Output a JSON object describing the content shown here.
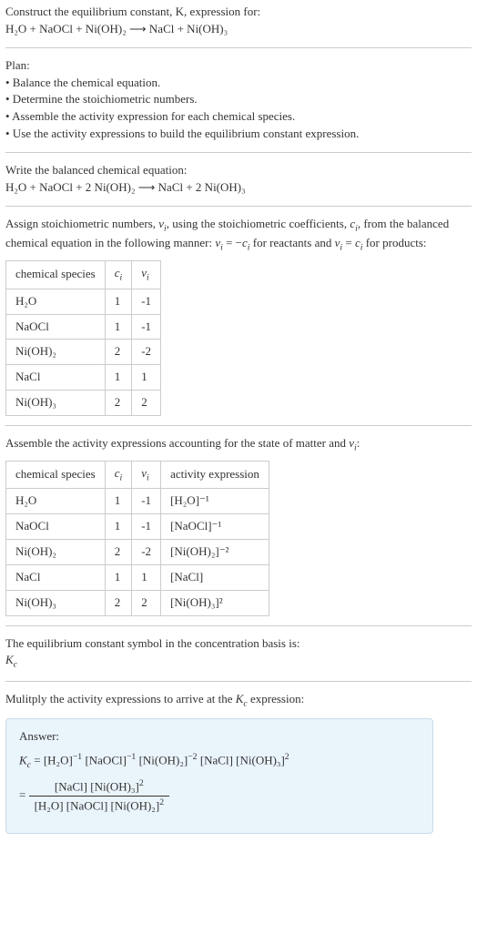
{
  "intro1": "Construct the equilibrium constant, K, expression for:",
  "eq_unbalanced": "H₂O + NaOCl + Ni(OH)₂  ⟶  NaCl + Ni(OH)₃",
  "plan_title": "Plan:",
  "plan_items": [
    "• Balance the chemical equation.",
    "• Determine the stoichiometric numbers.",
    "• Assemble the activity expression for each chemical species.",
    "• Use the activity expressions to build the equilibrium constant expression."
  ],
  "balanced_title": "Write the balanced chemical equation:",
  "eq_balanced": "H₂O + NaOCl + 2 Ni(OH)₂  ⟶  NaCl + 2 Ni(OH)₃",
  "assign_text_a": "Assign stoichiometric numbers, ",
  "assign_text_b": ", using the stoichiometric coefficients, ",
  "assign_text_c": ", from the balanced chemical equation in the following manner: ",
  "assign_text_d": " for reactants and ",
  "assign_text_e": " for products:",
  "headers": {
    "species": "chemical species",
    "ci": "cᵢ",
    "vi": "νᵢ",
    "activity": "activity expression"
  },
  "table1": [
    {
      "sp": "H₂O",
      "c": "1",
      "v": "-1"
    },
    {
      "sp": "NaOCl",
      "c": "1",
      "v": "-1"
    },
    {
      "sp": "Ni(OH)₂",
      "c": "2",
      "v": "-2"
    },
    {
      "sp": "NaCl",
      "c": "1",
      "v": "1"
    },
    {
      "sp": "Ni(OH)₃",
      "c": "2",
      "v": "2"
    }
  ],
  "assemble_text_a": "Assemble the activity expressions accounting for the state of matter and ",
  "assemble_text_b": ":",
  "table2": [
    {
      "sp": "H₂O",
      "c": "1",
      "v": "-1",
      "a": "[H₂O]⁻¹"
    },
    {
      "sp": "NaOCl",
      "c": "1",
      "v": "-1",
      "a": "[NaOCl]⁻¹"
    },
    {
      "sp": "Ni(OH)₂",
      "c": "2",
      "v": "-2",
      "a": "[Ni(OH)₂]⁻²"
    },
    {
      "sp": "NaCl",
      "c": "1",
      "v": "1",
      "a": "[NaCl]"
    },
    {
      "sp": "Ni(OH)₃",
      "c": "2",
      "v": "2",
      "a": "[Ni(OH)₃]²"
    }
  ],
  "eq_const_text": "The equilibrium constant symbol in the concentration basis is:",
  "kc_symbol": "K",
  "kc_sub": "c",
  "multiply_text_a": "Mulitply the activity expressions to arrive at the ",
  "multiply_text_b": " expression:",
  "answer_label": "Answer:",
  "ans_line1": "Kc = [H₂O]⁻¹ [NaOCl]⁻¹ [Ni(OH)₂]⁻² [NaCl] [Ni(OH)₃]²",
  "ans_frac_num": "[NaCl] [Ni(OH)₃]²",
  "ans_frac_den": "[H₂O] [NaOCl] [Ni(OH)₂]²",
  "chart_data": {
    "type": "table",
    "title": "Stoichiometric numbers and activity expressions",
    "tables": [
      {
        "columns": [
          "chemical species",
          "cᵢ",
          "νᵢ"
        ],
        "rows": [
          [
            "H₂O",
            "1",
            "-1"
          ],
          [
            "NaOCl",
            "1",
            "-1"
          ],
          [
            "Ni(OH)₂",
            "2",
            "-2"
          ],
          [
            "NaCl",
            "1",
            "1"
          ],
          [
            "Ni(OH)₃",
            "2",
            "2"
          ]
        ]
      },
      {
        "columns": [
          "chemical species",
          "cᵢ",
          "νᵢ",
          "activity expression"
        ],
        "rows": [
          [
            "H₂O",
            "1",
            "-1",
            "[H₂O]⁻¹"
          ],
          [
            "NaOCl",
            "1",
            "-1",
            "[NaOCl]⁻¹"
          ],
          [
            "Ni(OH)₂",
            "2",
            "-2",
            "[Ni(OH)₂]⁻²"
          ],
          [
            "NaCl",
            "1",
            "1",
            "[NaCl]"
          ],
          [
            "Ni(OH)₃",
            "2",
            "2",
            "[Ni(OH)₃]²"
          ]
        ]
      }
    ]
  }
}
